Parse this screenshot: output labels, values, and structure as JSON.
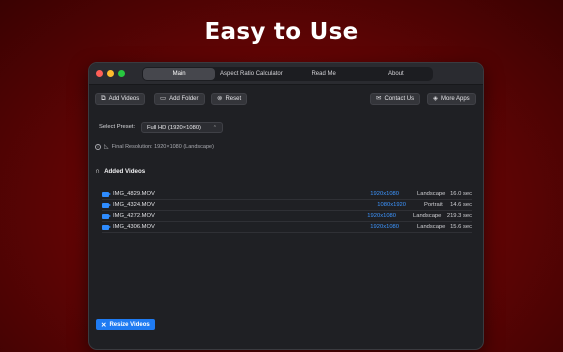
{
  "headline": "Easy to Use",
  "tabs": [
    {
      "label": "Main",
      "active": true
    },
    {
      "label": "Aspect Ratio Calculator",
      "active": false
    },
    {
      "label": "Read Me",
      "active": false
    },
    {
      "label": "About",
      "active": false
    }
  ],
  "toolbar": {
    "add_videos": "Add Videos",
    "add_folder": "Add Folder",
    "reset": "Reset",
    "contact_us": "Contact Us",
    "more_apps": "More Apps"
  },
  "preset": {
    "label": "Select Preset:",
    "value": "Full HD (1920×1080)"
  },
  "final_resolution": "Final Resolution: 1920×1080 (Landscape)",
  "added_videos": {
    "title": "Added Videos",
    "rows": [
      {
        "name": "IMG_4829.MOV",
        "resolution": "1920x1080",
        "orientation": "Landscape",
        "duration": "16.0 sec"
      },
      {
        "name": "IMG_4324.MOV",
        "resolution": "1080x1920",
        "orientation": "Portrait",
        "duration": "14.6 sec"
      },
      {
        "name": "IMG_4272.MOV",
        "resolution": "1920x1080",
        "orientation": "Landscape",
        "duration": "219.3 sec"
      },
      {
        "name": "IMG_4306.MOV",
        "resolution": "1920x1080",
        "orientation": "Landscape",
        "duration": "15.6 sec"
      }
    ]
  },
  "resize_button": "Resize Videos",
  "colors": {
    "accent": "#1f7bf2",
    "resolution_text": "#3d95ff",
    "background": "#6a0505"
  },
  "icons": {
    "add_videos": "add-videos-icon",
    "add_folder": "add-folder-icon",
    "reset": "reset-icon",
    "contact_us": "envelope-icon",
    "more_apps": "apps-icon",
    "info": "info-icon",
    "section": "headphones-icon",
    "row": "video-camera-icon",
    "resize": "resize-icon"
  }
}
